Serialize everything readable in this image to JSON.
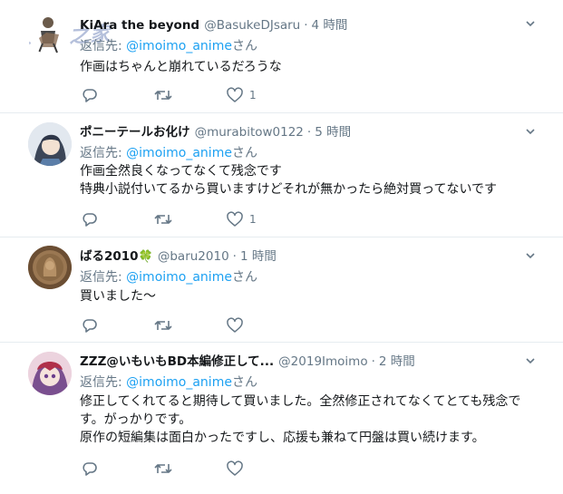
{
  "watermark": "动漫之家",
  "tweets": [
    {
      "name": "KiAra the beyond",
      "handle": "@BasukeDJsaru",
      "time": "4 時間",
      "reply_prefix": "返信先: ",
      "reply_mention": "@imoimo_anime",
      "reply_suffix": "さん",
      "lines": [
        "作画はちゃんと崩れているだろうな"
      ],
      "likes": "1"
    },
    {
      "name": "ポニーテールお化け",
      "handle": "@murabitow0122",
      "time": "5 時間",
      "reply_prefix": "返信先: ",
      "reply_mention": "@imoimo_anime",
      "reply_suffix": "さん",
      "lines": [
        "作画全然良くなってなくて残念です",
        "特典小説付いてるから買いますけどそれが無かったら絶対買ってないです"
      ],
      "likes": "1"
    },
    {
      "name": "ばる2010",
      "name_icon": "🍀",
      "handle": "@baru2010",
      "time": "1 時間",
      "reply_prefix": "返信先: ",
      "reply_mention": "@imoimo_anime",
      "reply_suffix": "さん",
      "lines": [
        "買いました〜"
      ],
      "likes": ""
    },
    {
      "name": "ZZZ@いもいもBD本編修正して...",
      "handle": "@2019Imoimo",
      "time": "2 時間",
      "reply_prefix": "返信先: ",
      "reply_mention": "@imoimo_anime",
      "reply_suffix": "さん",
      "lines": [
        "修正してくれてると期待して買いました。全然修正されてなくてとても残念で",
        "す。がっかりです。",
        "原作の短編集は面白かったですし、応援も兼ねて円盤は買い続けます。"
      ],
      "likes": ""
    }
  ],
  "colors": {
    "accent": "#1da1f2",
    "muted": "#657786",
    "text": "#14171a",
    "divider": "#e6ecf0"
  }
}
